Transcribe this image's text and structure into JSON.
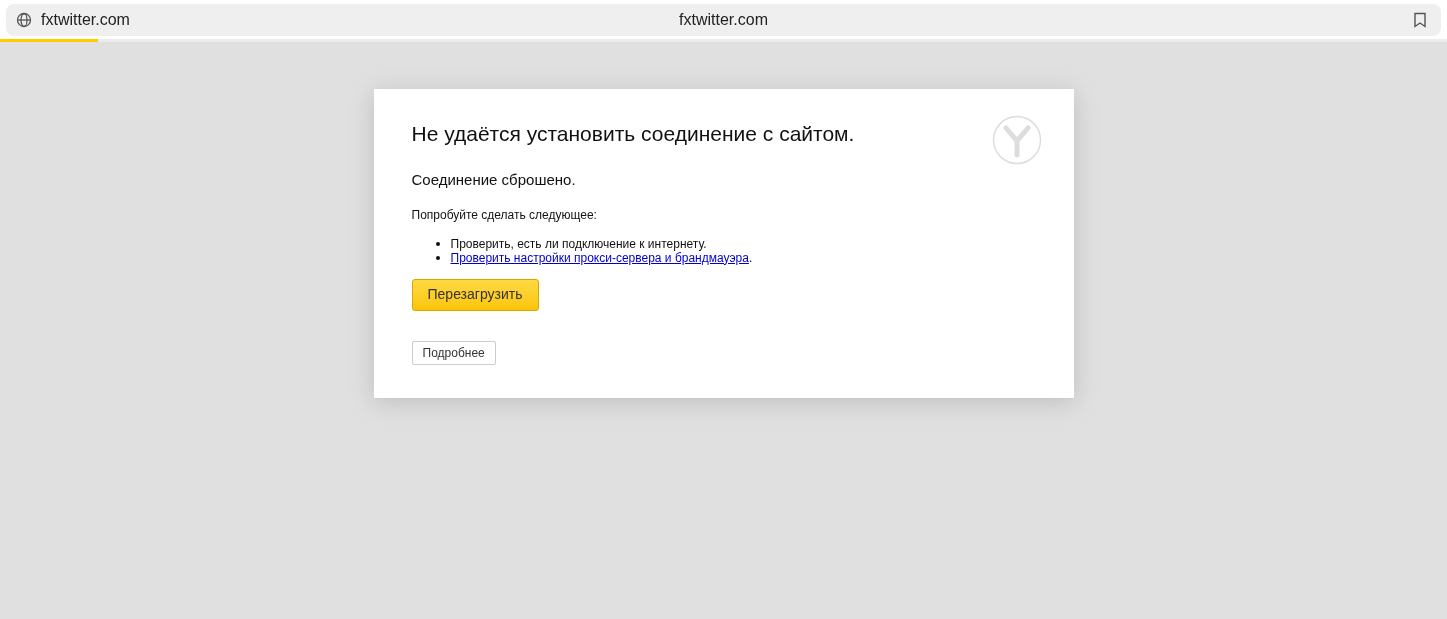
{
  "address_bar": {
    "url": "fxtwitter.com",
    "title": "fxtwitter.com"
  },
  "loading": {
    "level": 0.068
  },
  "error_card": {
    "heading": "Не удаётся установить соединение с сайтом.",
    "message": "Соединение сброшено.",
    "suggestions_title": "Попробуйте сделать следующее:",
    "suggestions": [
      {
        "kind": "text",
        "text": "Проверить, есть ли подключение к интернету."
      },
      {
        "kind": "link",
        "text": "Проверить настройки прокси-сервера и брандмауэра",
        "suffix": "."
      }
    ],
    "reload_button": "Перезагрузить",
    "details_button": "Подробнее"
  }
}
